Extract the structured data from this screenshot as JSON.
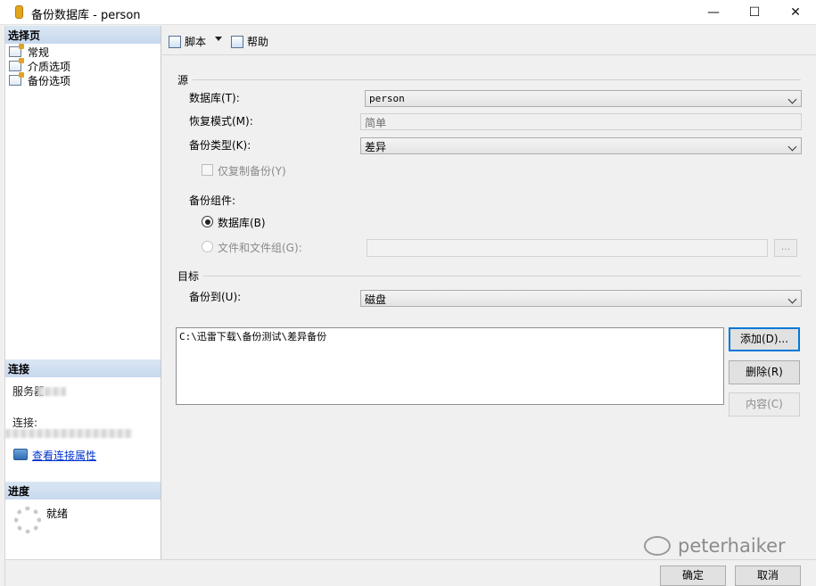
{
  "window": {
    "title": "备份数据库 - person",
    "minimize": "—",
    "maximize": "☐",
    "close": "✕"
  },
  "leftpane": {
    "select_page_header": "选择页",
    "pages": [
      "常规",
      "介质选项",
      "备份选项"
    ],
    "connection_header": "连接",
    "server_label": "服务器:",
    "connection_label": "连接:",
    "view_connection_properties": "查看连接属性",
    "progress_header": "进度",
    "progress_status": "就绪"
  },
  "toolbar": {
    "script_label": "脚本",
    "help_label": "帮助"
  },
  "source": {
    "group_label": "源",
    "database_label": "数据库(T):",
    "database_value": "person",
    "recovery_model_label": "恢复模式(M):",
    "recovery_model_value": "简单",
    "backup_type_label": "备份类型(K):",
    "backup_type_value": "差异",
    "copy_only_label": "仅复制备份(Y)",
    "component_label": "备份组件:",
    "component_database": "数据库(B)",
    "component_files": "文件和文件组(G):",
    "browse_label": "..."
  },
  "destination": {
    "group_label": "目标",
    "backup_to_label": "备份到(U):",
    "backup_to_value": "磁盘",
    "paths": [
      "C:\\迅雷下载\\备份测试\\差异备份"
    ],
    "add_label": "添加(D)...",
    "remove_label": "删除(R)",
    "contents_label": "内容(C)"
  },
  "footer": {
    "ok_label": "确定",
    "cancel_label": "取消"
  },
  "watermark": {
    "text": "peterhaiker"
  }
}
